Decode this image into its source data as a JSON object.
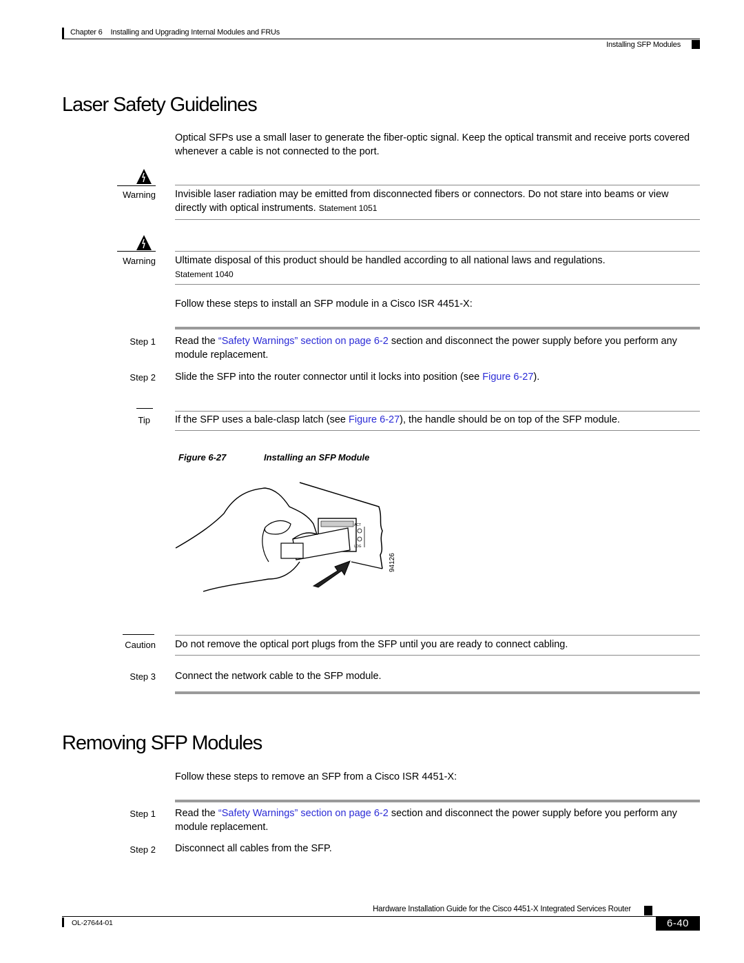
{
  "header": {
    "chapter": "Chapter 6",
    "chapter_title": "Installing and Upgrading Internal Modules and FRUs",
    "section": "Installing SFP Modules"
  },
  "laser_section": {
    "title": "Laser Safety Guidelines",
    "intro": "Optical SFPs use a small laser to generate the fiber-optic signal. Keep the optical transmit and receive ports covered whenever a cable is not connected to the port.",
    "warnings": [
      {
        "label": "Warning",
        "icon": "warning-triangle-icon",
        "text": "Invisible laser radiation may be emitted from disconnected fibers or connectors. Do not stare into beams or view directly with optical instruments.",
        "statement": "Statement 1051"
      },
      {
        "label": "Warning",
        "icon": "warning-triangle-icon",
        "text": "Ultimate disposal of this product should be handled according to all national laws and regulations.",
        "statement": "Statement 1040"
      }
    ],
    "steps_intro": "Follow these steps to install an SFP module in a Cisco ISR 4451-X:",
    "steps": [
      {
        "label": "Step 1",
        "pre": "Read the ",
        "link": "“Safety Warnings” section on page 6-2",
        "post": " section and disconnect the power supply before you perform any module replacement."
      },
      {
        "label": "Step 2",
        "pre": "Slide the SFP into the router connector until it locks into position (see ",
        "link": "Figure 6-27",
        "post": ")."
      }
    ],
    "tip": {
      "label": "Tip",
      "pre": "If the SFP uses a bale-clasp latch (see ",
      "link": "Figure 6-27",
      "post": "), the handle should be on top of the SFP module."
    },
    "figure": {
      "number": "Figure 6-27",
      "title": "Installing an SFP Module",
      "art_id": "94126",
      "led_labels": [
        "ACT",
        "LOG"
      ]
    },
    "caution": {
      "label": "Caution",
      "text": "Do not remove the optical port plugs from the SFP until you are ready to connect cabling."
    },
    "step3": {
      "label": "Step 3",
      "text": "Connect the network cable to the SFP module."
    }
  },
  "removing_section": {
    "title": "Removing SFP Modules",
    "steps_intro": "Follow these steps to remove an SFP from a Cisco ISR 4451-X:",
    "steps": [
      {
        "label": "Step 1",
        "pre": "Read the ",
        "link": "“Safety Warnings” section on page 6-2",
        "post": " section and disconnect the power supply before you perform any module replacement."
      },
      {
        "label": "Step 2",
        "text": "Disconnect all cables from the SFP."
      }
    ]
  },
  "footer": {
    "guide_title": "Hardware Installation Guide for the Cisco 4451-X Integrated Services Router",
    "doc_number": "OL-27644-01",
    "page_number": "6-40"
  },
  "colors": {
    "link": "#2b2bd6",
    "text": "#000000",
    "rule": "#888888"
  }
}
